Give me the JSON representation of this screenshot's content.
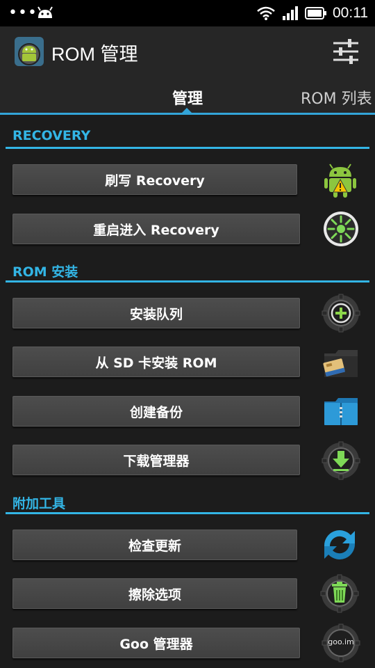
{
  "status_bar": {
    "time": "00:11",
    "icons": [
      "notification-dots-icon",
      "android-debug-icon",
      "wifi-icon",
      "signal-icon",
      "battery-icon"
    ]
  },
  "action_bar": {
    "title": "ROM 管理",
    "app_icon": "rom-manager-app-icon",
    "settings_icon": "settings-sliders-icon"
  },
  "tabs": [
    {
      "label": "管理",
      "selected": true
    },
    {
      "label": "ROM 列表",
      "selected": false
    }
  ],
  "sections": [
    {
      "title": "RECOVERY",
      "items": [
        {
          "label": "刷写 Recovery",
          "icon": "android-warning-icon"
        },
        {
          "label": "重启进入 Recovery",
          "icon": "reboot-icon"
        }
      ]
    },
    {
      "title": "ROM 安装",
      "items": [
        {
          "label": "安装队列",
          "icon": "add-queue-icon"
        },
        {
          "label": "从 SD 卡安装 ROM",
          "icon": "sd-card-folder-icon"
        },
        {
          "label": "创建备份",
          "icon": "backup-folder-icon"
        },
        {
          "label": "下载管理器",
          "icon": "download-icon"
        }
      ]
    },
    {
      "title": "附加工具",
      "items": [
        {
          "label": "检查更新",
          "icon": "refresh-icon"
        },
        {
          "label": "擦除选项",
          "icon": "trash-icon"
        },
        {
          "label": "Goo 管理器",
          "icon": "goo-im-icon"
        }
      ]
    }
  ],
  "icon_texts": {
    "goo": "goo.im"
  },
  "colors": {
    "accent": "#33b5e5",
    "background": "#1c1c1c",
    "bar": "#262626"
  }
}
